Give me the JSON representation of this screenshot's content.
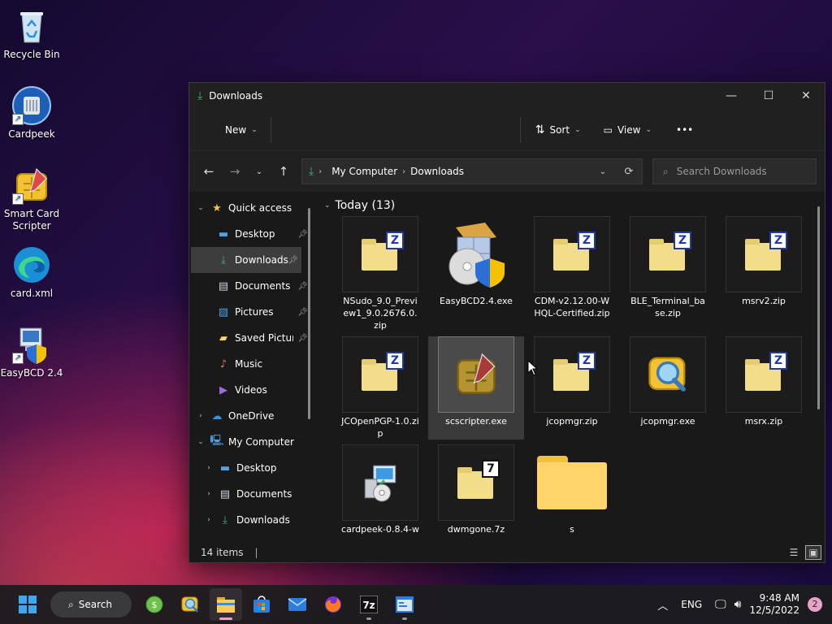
{
  "desktop": {
    "icons": [
      {
        "label": "Recycle Bin",
        "icon": "recycle-bin-icon"
      },
      {
        "label": "Cardpeek",
        "icon": "cardpeek-icon"
      },
      {
        "label": "Smart Card Scripter",
        "icon": "smart-card-scripter-icon"
      },
      {
        "label": "card.xml",
        "icon": "edge-icon"
      },
      {
        "label": "EasyBCD 2.4",
        "icon": "easybcd-icon"
      }
    ]
  },
  "window": {
    "title": "Downloads",
    "commandbar": {
      "new_label": "New",
      "sort_label": "Sort",
      "view_label": "View",
      "more_label": "•••"
    },
    "address": {
      "segments": [
        "My Computer",
        "Downloads"
      ]
    },
    "search": {
      "placeholder": "Search Downloads"
    },
    "nav": {
      "quick_access": "Quick access",
      "quick_items": [
        {
          "label": "Desktop"
        },
        {
          "label": "Downloads"
        },
        {
          "label": "Documents"
        },
        {
          "label": "Pictures"
        },
        {
          "label": "Saved Pictur"
        },
        {
          "label": "Music"
        },
        {
          "label": "Videos"
        }
      ],
      "onedrive": "OneDrive",
      "my_computer": "My Computer",
      "computer_items": [
        {
          "label": "Desktop"
        },
        {
          "label": "Documents"
        },
        {
          "label": "Downloads"
        }
      ]
    },
    "group": {
      "header": "Today (13)"
    },
    "files": [
      {
        "name": "NSudo_9.0_Preview1_9.0.2676.0.zip",
        "type": "zip"
      },
      {
        "name": "EasyBCD2.4.exe",
        "type": "exe"
      },
      {
        "name": "CDM-v2.12.00-WHQL-Certified.zip",
        "type": "zip"
      },
      {
        "name": "BLE_Terminal_base.zip",
        "type": "zip"
      },
      {
        "name": "msrv2.zip",
        "type": "zip"
      },
      {
        "name": "JCOpenPGP-1.0.zip",
        "type": "zip"
      },
      {
        "name": "scscripter.exe",
        "type": "exe"
      },
      {
        "name": "jcopmgr.zip",
        "type": "zip"
      },
      {
        "name": "jcopmgr.exe",
        "type": "exe"
      },
      {
        "name": "msrx.zip",
        "type": "zip"
      },
      {
        "name": "cardpeek-0.8.4-w",
        "type": "exe"
      },
      {
        "name": "dwmgone.7z",
        "type": "7z"
      },
      {
        "name": "s",
        "type": "folder"
      }
    ],
    "status": {
      "items": "14 items"
    }
  },
  "taskbar": {
    "search_label": "Search",
    "tray": {
      "lang": "ENG",
      "time": "9:48 AM",
      "date": "12/5/2022",
      "notifications": "2"
    }
  },
  "colors": {
    "accent": "#3bb56e",
    "selection": "#3d3d3d",
    "window_bg": "#191919",
    "zip_blue": "#1e3aa8",
    "folder": "#ffd56b"
  }
}
